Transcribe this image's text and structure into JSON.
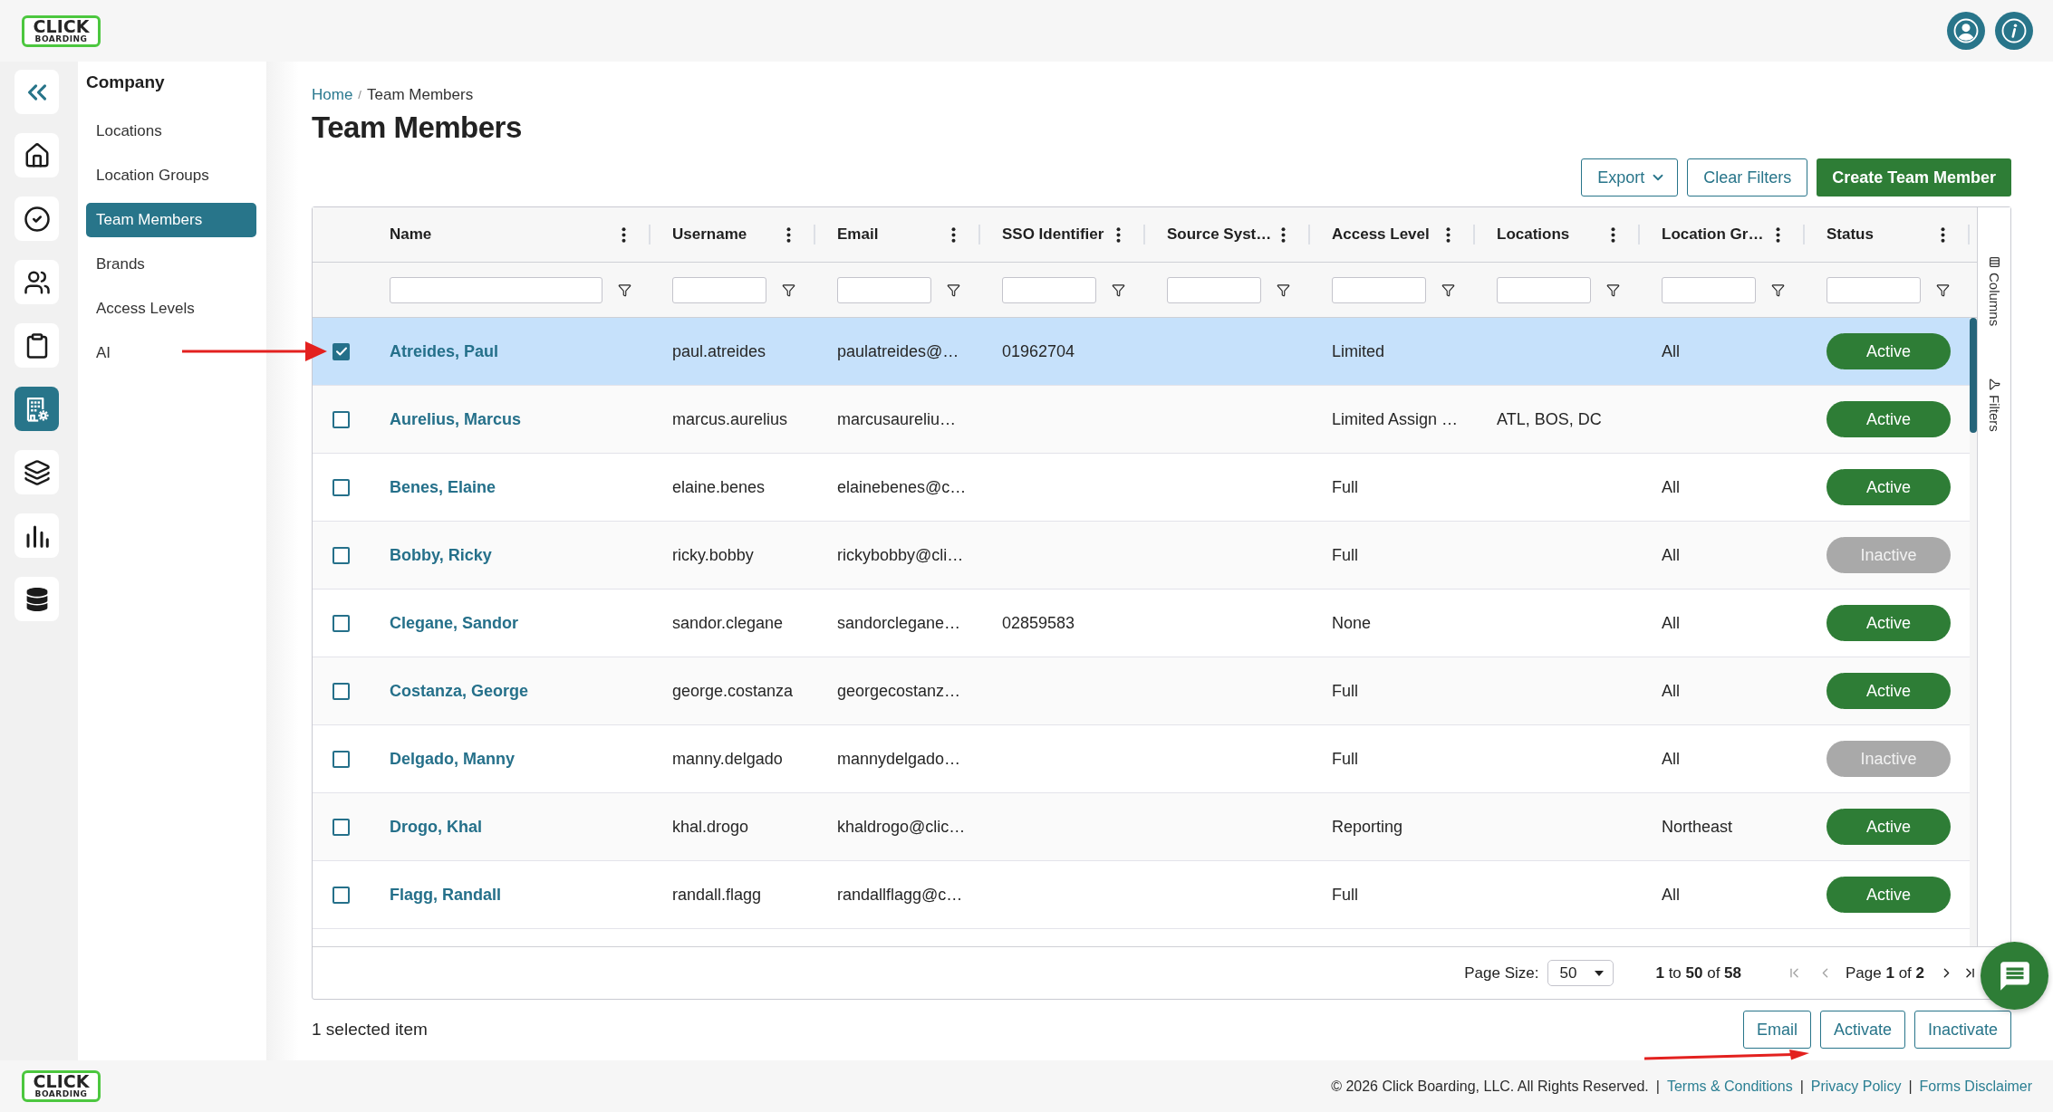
{
  "header": {
    "logo": {
      "word": "CLICK",
      "tagline": "BOARDING"
    }
  },
  "icon_rail": {
    "items": [
      {
        "selected": false
      },
      {
        "selected": false
      },
      {
        "selected": false
      },
      {
        "selected": false
      },
      {
        "selected": true
      },
      {
        "selected": false
      },
      {
        "selected": false
      },
      {
        "selected": false
      }
    ]
  },
  "subnav": {
    "title": "Company",
    "items": [
      {
        "label": "Locations",
        "selected": false
      },
      {
        "label": "Location Groups",
        "selected": false
      },
      {
        "label": "Team Members",
        "selected": true
      },
      {
        "label": "Brands",
        "selected": false
      },
      {
        "label": "Access Levels",
        "selected": false
      },
      {
        "label": "AI",
        "selected": false
      }
    ]
  },
  "breadcrumb": [
    {
      "kind": "link",
      "text": "Home"
    },
    {
      "kind": "separator",
      "text": "/"
    },
    {
      "kind": "current",
      "text": "Team Members"
    }
  ],
  "page_title": "Team Members",
  "toolbar": {
    "buttons": [
      {
        "label": "Export",
        "kind": "dropdown"
      },
      {
        "label": "Clear Filters",
        "kind": "outline"
      },
      {
        "label": "Create Team Member",
        "kind": "primary"
      }
    ]
  },
  "table": {
    "columns": [
      {
        "label": "Name"
      },
      {
        "label": "Username"
      },
      {
        "label": "Email"
      },
      {
        "label": "SSO Identifier"
      },
      {
        "label": "Source Syst…"
      },
      {
        "label": "Access Level"
      },
      {
        "label": "Locations"
      },
      {
        "label": "Location Gr…"
      },
      {
        "label": "Status"
      }
    ],
    "rows": [
      {
        "selected": true,
        "name": "Atreides, Paul",
        "username": "paul.atreides",
        "email": "paulatreides@…",
        "sso_identifier": "01962704",
        "access_level": "Limited",
        "location_group": "All",
        "status": {
          "label": "Active",
          "active": true
        }
      },
      {
        "selected": false,
        "name": "Aurelius, Marcus",
        "username": "marcus.aurelius",
        "email": "marcusaureliu…",
        "access_level": "Limited Assign …",
        "locations": "ATL, BOS, DC",
        "status": {
          "label": "Active",
          "active": true
        }
      },
      {
        "selected": false,
        "name": "Benes, Elaine",
        "username": "elaine.benes",
        "email": "elainebenes@c…",
        "access_level": "Full",
        "location_group": "All",
        "status": {
          "label": "Active",
          "active": true
        }
      },
      {
        "selected": false,
        "name": "Bobby, Ricky",
        "username": "ricky.bobby",
        "email": "rickybobby@cli…",
        "access_level": "Full",
        "location_group": "All",
        "status": {
          "label": "Inactive",
          "active": false
        }
      },
      {
        "selected": false,
        "name": "Clegane, Sandor",
        "username": "sandor.clegane",
        "email": "sandorclegane…",
        "sso_identifier": "02859583",
        "access_level": "None",
        "location_group": "All",
        "status": {
          "label": "Active",
          "active": true
        }
      },
      {
        "selected": false,
        "name": "Costanza, George",
        "username": "george.costanza",
        "email": "georgecostanz…",
        "access_level": "Full",
        "location_group": "All",
        "status": {
          "label": "Active",
          "active": true
        }
      },
      {
        "selected": false,
        "name": "Delgado, Manny",
        "username": "manny.delgado",
        "email": "mannydelgado…",
        "access_level": "Full",
        "location_group": "All",
        "status": {
          "label": "Inactive",
          "active": false
        }
      },
      {
        "selected": false,
        "name": "Drogo, Khal",
        "username": "khal.drogo",
        "email": "khaldrogo@clic…",
        "access_level": "Reporting",
        "location_group": "Northeast",
        "status": {
          "label": "Active",
          "active": true
        }
      },
      {
        "selected": false,
        "name": "Flagg, Randall",
        "username": "randall.flagg",
        "email": "randallflagg@c…",
        "access_level": "Full",
        "location_group": "All",
        "status": {
          "label": "Active",
          "active": true
        }
      }
    ]
  },
  "side_panel": {
    "tabs": [
      {
        "label": "Columns"
      },
      {
        "label": "Filters"
      }
    ]
  },
  "pagination": {
    "page_size_label": "Page Size:",
    "page_size": "50",
    "range": "**1** to **50** of **58**",
    "page": "Page **1** of **2**",
    "nav": [
      {
        "kind": "first",
        "disabled": true
      },
      {
        "kind": "previous",
        "disabled": true
      },
      {
        "kind": "next",
        "disabled": false
      },
      {
        "kind": "last",
        "disabled": false
      }
    ]
  },
  "selection_bar": {
    "summary": "1 selected item",
    "buttons": [
      {
        "label": "Email"
      },
      {
        "label": "Activate"
      },
      {
        "label": "Inactivate"
      }
    ]
  },
  "footer": {
    "logo": {
      "word": "CLICK",
      "tagline": "BOARDING"
    },
    "parts": [
      {
        "kind": "text",
        "text": "© 2026 Click Boarding, LLC. All Rights Reserved."
      },
      {
        "kind": "separator",
        "text": "|"
      },
      {
        "kind": "link",
        "text": "Terms & Conditions"
      },
      {
        "kind": "separator",
        "text": "|"
      },
      {
        "kind": "link",
        "text": "Privacy Policy"
      },
      {
        "kind": "separator",
        "text": "|"
      },
      {
        "kind": "link",
        "text": "Forms Disclaimer"
      }
    ]
  }
}
